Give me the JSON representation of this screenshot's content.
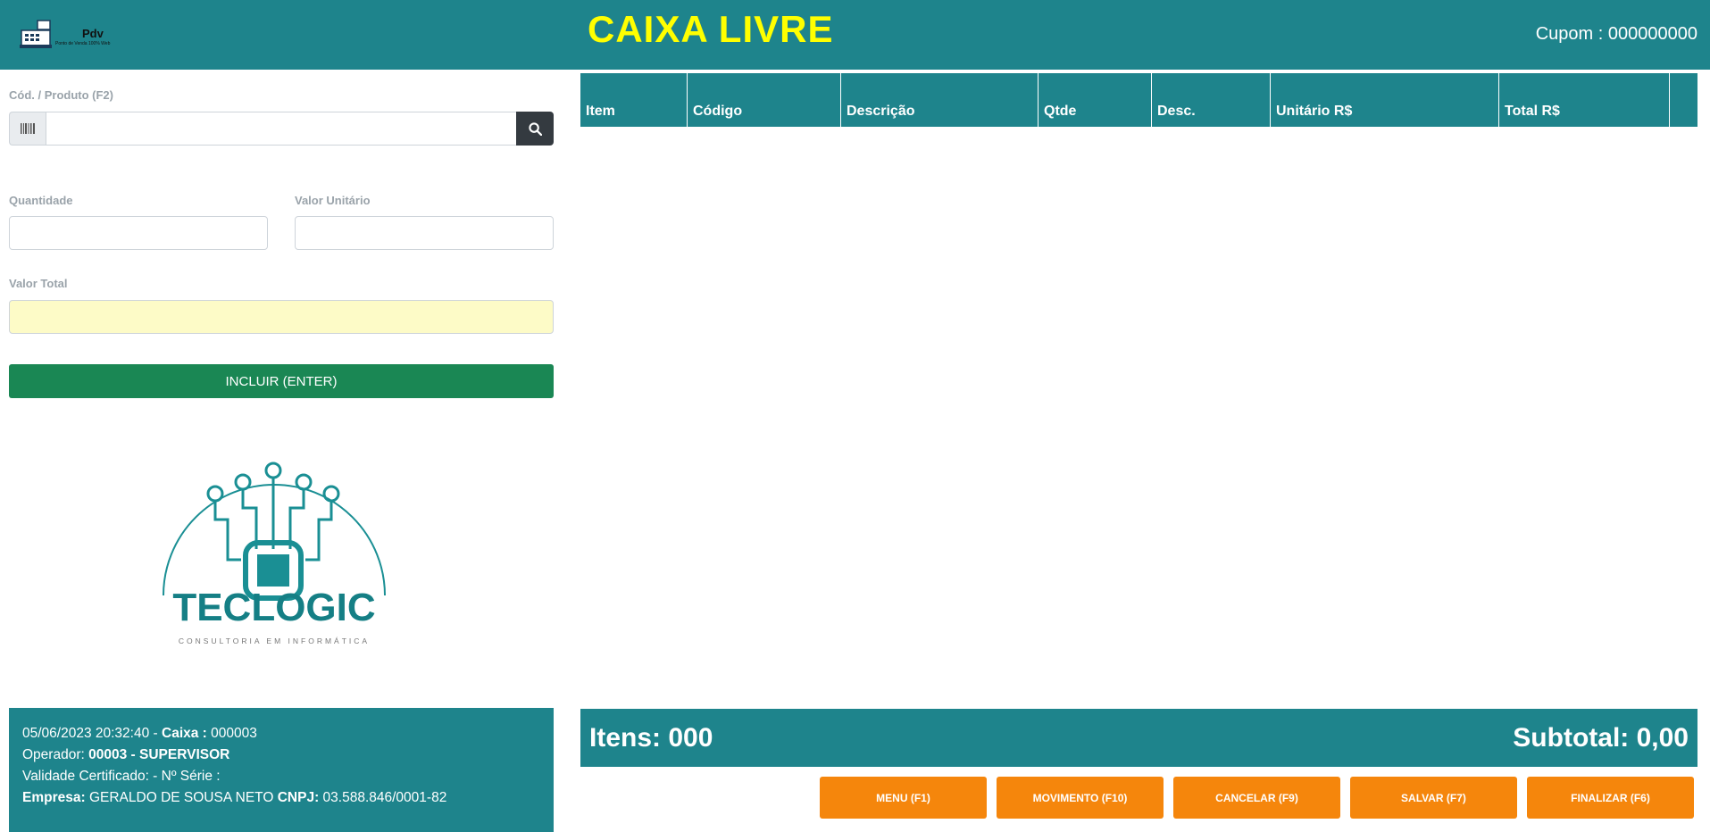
{
  "header": {
    "logo_name": "Pdv",
    "logo_tagline": "Ponto de Venda 100% Web",
    "status": "CAIXA LIVRE",
    "cupom_label": "Cupom :",
    "cupom_number": "000000000"
  },
  "form": {
    "produto_label": "Cód. / Produto (F2)",
    "produto_value": "",
    "quantidade_label": "Quantidade",
    "quantidade_value": "",
    "valor_unitario_label": "Valor Unitário",
    "valor_unitario_value": "",
    "valor_total_label": "Valor Total",
    "valor_total_value": "",
    "incluir_label": "INCLUIR (ENTER)"
  },
  "brand": {
    "name": "TECLOGIC",
    "tagline": "CONSULTORIA EM INFORMÁTICA"
  },
  "info": {
    "datetime": "05/06/2023 20:32:40",
    "caixa_label": "Caixa :",
    "caixa_value": "000003",
    "operador_label": "Operador:",
    "operador_value": "00003 - SUPERVISOR",
    "certificado_text": "Validade Certificado: - Nº Série :",
    "empresa_label": "Empresa:",
    "empresa_value": "GERALDO DE SOUSA NETO",
    "cnpj_label": "CNPJ:",
    "cnpj_value": "03.588.846/0001-82"
  },
  "table": {
    "columns": [
      "Item",
      "Código",
      "Descrição",
      "Qtde",
      "Desc.",
      "Unitário R$",
      "Total R$",
      ""
    ],
    "rows": []
  },
  "totals": {
    "itens_text": "Itens: 000",
    "subtotal_text": "Subtotal: 0,00"
  },
  "actions": {
    "menu": "MENU (F1)",
    "movimento": "MOVIMENTO (F10)",
    "cancelar": "CANCELAR (F9)",
    "salvar": "SALVAR (F7)",
    "finalizar": "FINALIZAR (F6)"
  },
  "colors": {
    "teal": "#1e848c",
    "status_yellow": "#ffff00",
    "incluir_green": "#1a8754",
    "action_orange": "#f5860c",
    "total_field_yellow": "#fdfbc7"
  },
  "icons": {
    "barcode": "barcode-icon",
    "search": "search-icon",
    "logo": "cash-register-icon"
  }
}
